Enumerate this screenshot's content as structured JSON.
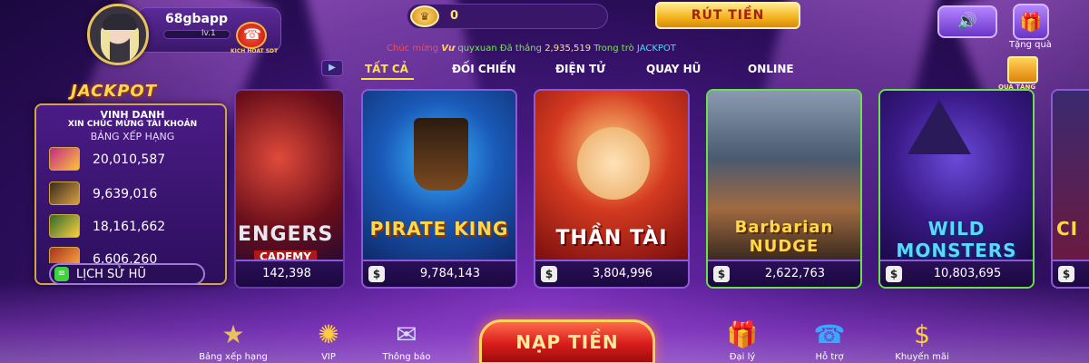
{
  "header": {
    "username": "68gbapp",
    "level": "lv.1",
    "phone_badge_text": "KICH HOAT SDT",
    "coins": "0",
    "withdraw_label": "RÚT TIỀN",
    "gift_label": "Tặng quà"
  },
  "ticker": {
    "prefix": "Chúc mừng",
    "tag": "Vư",
    "user": "quyxuan",
    "won": "Đã thắng",
    "amount": "2,935,519",
    "in_game": "Trong trò",
    "game": "JACKPOT"
  },
  "tabs": [
    {
      "label": "TẤT CẢ"
    },
    {
      "label": "ĐỐI CHIẾN"
    },
    {
      "label": "ĐIỆN TỬ"
    },
    {
      "label": "QUAY HŨ"
    },
    {
      "label": "ONLINE"
    }
  ],
  "gift_box_label": "QUÀ TẶNG",
  "jackpot": {
    "title": "JACKPOT",
    "line1": "VINH DANH",
    "line2": "XIN CHÚC MỪNG TÀI KHOẢN",
    "line3": "BẢNG XẾP HẠNG",
    "entries": [
      {
        "value": "20,010,587"
      },
      {
        "value": "9,639,016"
      },
      {
        "value": "18,161,662"
      },
      {
        "value": "6,606,260"
      }
    ],
    "history_label": "LỊCH SỬ HŨ"
  },
  "games": [
    {
      "name": "ENGERS",
      "sub": "CADEMY",
      "jackpot": "142,398"
    },
    {
      "name": "PIRATE KING",
      "jackpot": "9,784,143"
    },
    {
      "name": "THẦN TÀI",
      "jackpot": "3,804,996"
    },
    {
      "name": "Barbarian NUDGE",
      "jackpot": "2,622,763"
    },
    {
      "name": "WILD MONSTERS",
      "jackpot": "10,803,695"
    },
    {
      "name": "CI",
      "jackpot": ""
    }
  ],
  "currency_symbol": "$",
  "bottom_nav": {
    "leaderboard": "Bảng xếp hạng",
    "vip": "VIP",
    "notice": "Thông báo",
    "deposit": "NẠP TIỀN",
    "agent": "Đại lý",
    "support": "Hỗ trợ",
    "promo": "Khuyến mãi"
  },
  "colors": {
    "accent_gold": "#ffd84a",
    "background": "#4a1a86",
    "deposit_red": "#d81c1c"
  }
}
